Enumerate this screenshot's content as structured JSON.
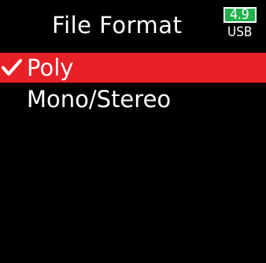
{
  "screen": {
    "title": "File Format",
    "background": "#000000"
  },
  "battery": {
    "value": "4.9",
    "source": "USB",
    "fill_color": "#21b24b"
  },
  "menu": {
    "highlight_color": "#e82027",
    "items": [
      {
        "label": "Poly",
        "checked": true,
        "selected": true
      },
      {
        "label": "Mono/Stereo",
        "checked": false,
        "selected": false
      }
    ]
  },
  "icons": {
    "check": "check-icon"
  }
}
